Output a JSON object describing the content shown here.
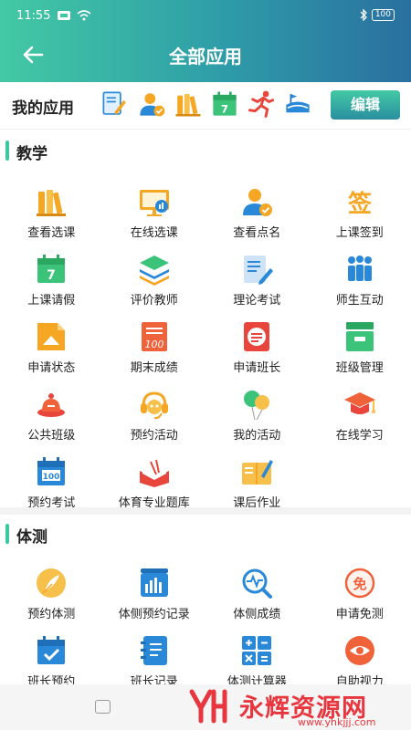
{
  "status_bar": {
    "time": "11:55",
    "battery": "100"
  },
  "header": {
    "title": "全部应用"
  },
  "my_apps": {
    "label": "我的应用",
    "edit_label": "编辑",
    "icons": [
      "note-edit-icon",
      "user-check-icon",
      "books-icon",
      "calendar-icon",
      "runner-icon",
      "stadium-icon"
    ]
  },
  "sections": [
    {
      "title": "教学",
      "items": [
        {
          "label": "查看选课",
          "icon": "books-icon"
        },
        {
          "label": "在线选课",
          "icon": "monitor-chart-icon"
        },
        {
          "label": "查看点名",
          "icon": "user-check-icon"
        },
        {
          "label": "上课签到",
          "icon": "sign-in-icon"
        },
        {
          "label": "上课请假",
          "icon": "calendar-icon"
        },
        {
          "label": "评价教师",
          "icon": "layers-icon"
        },
        {
          "label": "理论考试",
          "icon": "document-edit-icon"
        },
        {
          "label": "师生互动",
          "icon": "people-icon"
        },
        {
          "label": "申请状态",
          "icon": "home-upload-icon"
        },
        {
          "label": "期末成绩",
          "icon": "score-sheet-icon"
        },
        {
          "label": "申请班长",
          "icon": "form-icon"
        },
        {
          "label": "班级管理",
          "icon": "inbox-icon"
        },
        {
          "label": "公共班级",
          "icon": "bell-class-icon"
        },
        {
          "label": "预约活动",
          "icon": "headset-icon"
        },
        {
          "label": "我的活动",
          "icon": "balloons-icon"
        },
        {
          "label": "在线学习",
          "icon": "graduation-cap-icon"
        },
        {
          "label": "预约考试",
          "icon": "calendar-100-icon"
        },
        {
          "label": "体育专业题库",
          "icon": "open-book-icon"
        },
        {
          "label": "课后作业",
          "icon": "notebook-icon"
        }
      ]
    },
    {
      "title": "体测",
      "items": [
        {
          "label": "预约体测",
          "icon": "feather-icon"
        },
        {
          "label": "体侧预约记录",
          "icon": "bar-chart-icon"
        },
        {
          "label": "体侧成绩",
          "icon": "heartbeat-search-icon"
        },
        {
          "label": "申请免测",
          "icon": "exempt-icon"
        },
        {
          "label": "班长预约",
          "icon": "calendar-check-icon"
        },
        {
          "label": "班长记录",
          "icon": "notepad-icon"
        },
        {
          "label": "体测计算器",
          "icon": "calculator-icon"
        },
        {
          "label": "自助视力",
          "icon": "eye-icon"
        }
      ]
    }
  ],
  "watermark": {
    "name": "永辉资源网",
    "url": "www.yhkjjj.com"
  },
  "colors": {
    "accent": "#3ec7a0",
    "header_start": "#43c9a4",
    "header_end": "#2a6fa0",
    "orange": "#f5a623",
    "blue": "#2a88d8",
    "red": "#e8363f"
  }
}
